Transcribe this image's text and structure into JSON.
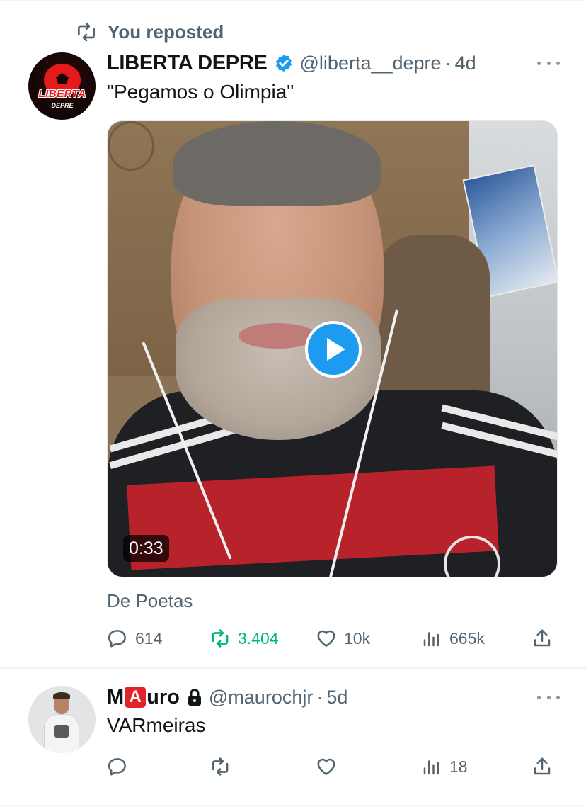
{
  "colors": {
    "accent": "#1d9bf0",
    "repost_green": "#00ba7c",
    "muted": "#536471",
    "text": "#0f1419"
  },
  "posts": [
    {
      "repost_label": "You reposted",
      "avatar_text": "LIBERTA",
      "avatar_subtext": "DEPRE",
      "display_name": "LIBERTA DEPRE",
      "verified": true,
      "handle": "@liberta__depre",
      "separator": "·",
      "time": "4d",
      "text": "\"Pegamos o Olimpia\"",
      "media": {
        "type": "video",
        "duration": "0:33"
      },
      "source": "De Poetas",
      "actions": {
        "replies": "614",
        "reposts": "3.404",
        "likes": "10k",
        "views": "665k"
      }
    },
    {
      "display_name_prefix": "M",
      "display_name_badge": "A",
      "display_name_suffix": "uro",
      "protected": true,
      "handle": "@maurochjr",
      "separator": "·",
      "time": "5d",
      "text": "VARmeiras",
      "actions": {
        "replies": "",
        "reposts": "",
        "likes": "",
        "views": "18"
      }
    }
  ]
}
